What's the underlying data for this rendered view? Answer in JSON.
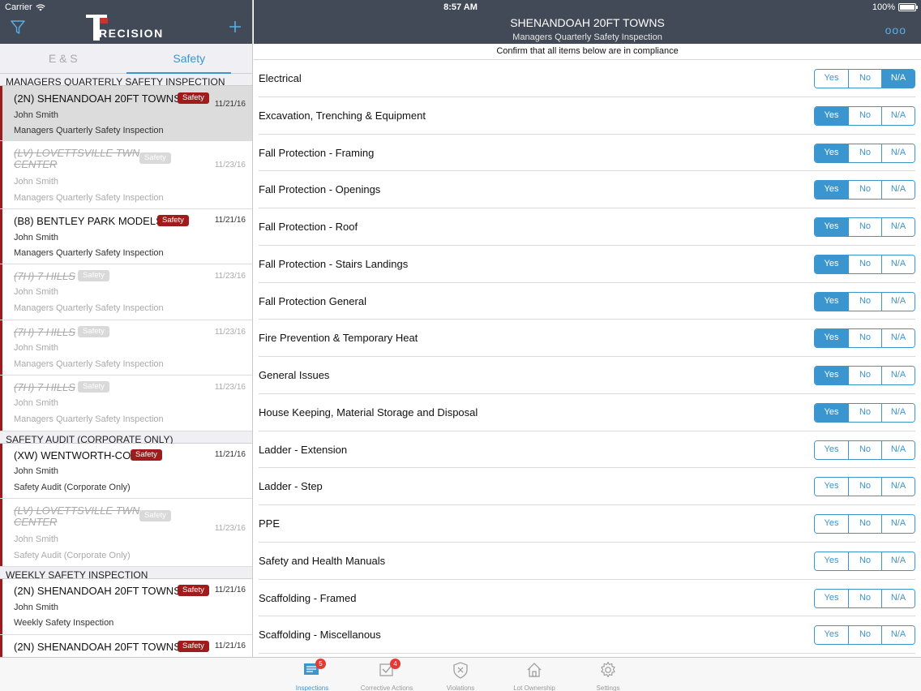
{
  "status": {
    "carrier": "Carrier",
    "time": "8:57 AM",
    "battery": "100%"
  },
  "left": {
    "logo": "RECISION",
    "tabs": [
      "E & S",
      "Safety"
    ],
    "sections": [
      {
        "title": "MANAGERS QUARTERLY SAFETY INSPECTION"
      },
      {
        "title": "SAFETY AUDIT (CORPORATE ONLY)"
      },
      {
        "title": "WEEKLY SAFETY INSPECTION"
      }
    ],
    "items": [
      {
        "title": "(2N) SHENANDOAH 20FT TOWNS",
        "badge": "Safety",
        "date": "11/21/16",
        "who": "John Smith",
        "kind": "Managers Quarterly Safety Inspection"
      },
      {
        "title": "(LV) LOVETTSVILLE TWN",
        "title2": "CENTER",
        "badge": "Safety",
        "date": "11/23/16",
        "who": "John Smith",
        "kind": "Managers Quarterly Safety Inspection"
      },
      {
        "title": "(B8) BENTLEY PARK MODELS",
        "badge": "Safety",
        "date": "11/21/16",
        "who": "John Smith",
        "kind": "Managers Quarterly Safety Inspection"
      },
      {
        "title": "(7H) 7 HILLS",
        "badge": "Safety",
        "date": "11/23/16",
        "who": "John Smith",
        "kind": "Managers Quarterly Safety Inspection"
      },
      {
        "title": "(7H) 7 HILLS",
        "badge": "Safety",
        "date": "11/23/16",
        "who": "John Smith",
        "kind": "Managers Quarterly Safety Inspection"
      },
      {
        "title": "(7H) 7 HILLS",
        "badge": "Safety",
        "date": "11/23/16",
        "who": "John Smith",
        "kind": "Managers Quarterly Safety Inspection"
      },
      {
        "title": "(XW) WENTWORTH-CO",
        "badge": "Safety",
        "date": "11/21/16",
        "who": "John Smith",
        "kind": "Safety Audit (Corporate Only)"
      },
      {
        "title": "(LV) LOVETTSVILLE TWN",
        "title2": "CENTER",
        "badge": "Safety",
        "date": "11/23/16",
        "who": "John Smith",
        "kind": "Safety Audit (Corporate Only)"
      },
      {
        "title": "(2N) SHENANDOAH 20FT TOWNS",
        "badge": "Safety",
        "date": "11/21/16",
        "who": "John Smith",
        "kind": "Weekly Safety Inspection"
      },
      {
        "title": "(2N) SHENANDOAH 20FT TOWNS",
        "badge": "Safety",
        "date": "11/21/16"
      }
    ]
  },
  "header": {
    "title": "SHENANDOAH 20FT TOWNS",
    "subtitle": "Managers Quarterly Safety Inspection",
    "more": "ooo"
  },
  "confirm": "Confirm that all items below are in compliance",
  "options": [
    "Yes",
    "No",
    "N/A"
  ],
  "checklist": [
    {
      "label": "Electrical",
      "selected": "N/A"
    },
    {
      "label": "Excavation, Trenching & Equipment",
      "selected": "Yes"
    },
    {
      "label": "Fall Protection - Framing",
      "selected": "Yes"
    },
    {
      "label": "Fall Protection - Openings",
      "selected": "Yes"
    },
    {
      "label": "Fall Protection - Roof",
      "selected": "Yes"
    },
    {
      "label": "Fall Protection - Stairs Landings",
      "selected": "Yes"
    },
    {
      "label": "Fall Protection General",
      "selected": "Yes"
    },
    {
      "label": "Fire Prevention & Temporary Heat",
      "selected": "Yes"
    },
    {
      "label": "General Issues",
      "selected": "Yes"
    },
    {
      "label": "House Keeping, Material Storage and Disposal",
      "selected": "Yes"
    },
    {
      "label": "Ladder - Extension",
      "selected": ""
    },
    {
      "label": "Ladder - Step",
      "selected": ""
    },
    {
      "label": "PPE",
      "selected": ""
    },
    {
      "label": "Safety and Health Manuals",
      "selected": ""
    },
    {
      "label": "Scaffolding - Framed",
      "selected": ""
    },
    {
      "label": "Scaffolding - Miscellanous",
      "selected": ""
    }
  ],
  "tabbar": [
    {
      "label": "Inspections",
      "badge": "5",
      "icon": "list-icon"
    },
    {
      "label": "Corrective Actions",
      "badge": "4",
      "icon": "check-box-icon"
    },
    {
      "label": "Violations",
      "icon": "shield-x-icon"
    },
    {
      "label": "Lot Ownership",
      "icon": "house-icon"
    },
    {
      "label": "Settings",
      "icon": "gear-icon"
    }
  ]
}
